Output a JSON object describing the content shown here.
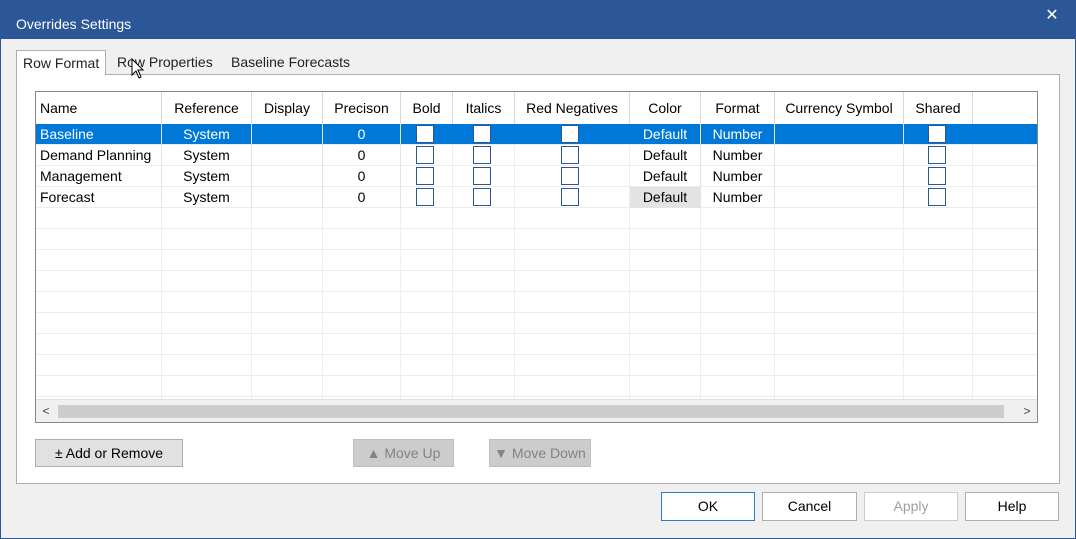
{
  "window": {
    "title": "Overrides Settings",
    "close_label": "✕"
  },
  "tabs": [
    {
      "label": "Row Format",
      "active": true
    },
    {
      "label": "Row Properties",
      "active": false
    },
    {
      "label": "Baseline Forecasts",
      "active": false
    }
  ],
  "grid": {
    "columns": [
      "Name",
      "Reference",
      "Display",
      "Precison",
      "Bold",
      "Italics",
      "Red Negatives",
      "Color",
      "Format",
      "Currency Symbol",
      "Shared"
    ],
    "rows": [
      {
        "name": "Baseline",
        "reference": "System",
        "display": "",
        "precision": "0",
        "bold": false,
        "italics": false,
        "red_negatives": false,
        "color": "Default",
        "format": "Number",
        "currency_symbol": "",
        "shared": false,
        "selected": true
      },
      {
        "name": "Demand Planning",
        "reference": "System",
        "display": "",
        "precision": "0",
        "bold": false,
        "italics": false,
        "red_negatives": false,
        "color": "Default",
        "format": "Number",
        "currency_symbol": "",
        "shared": false,
        "selected": false
      },
      {
        "name": "Management",
        "reference": "System",
        "display": "",
        "precision": "0",
        "bold": false,
        "italics": false,
        "red_negatives": false,
        "color": "Default",
        "format": "Number",
        "currency_symbol": "",
        "shared": false,
        "selected": false
      },
      {
        "name": "Forecast",
        "reference": "System",
        "display": "",
        "precision": "0",
        "bold": false,
        "italics": false,
        "red_negatives": false,
        "color": "Default",
        "format": "Number",
        "currency_symbol": "",
        "shared": false,
        "selected": false
      }
    ],
    "scroll_left": "<",
    "scroll_right": ">"
  },
  "actions": {
    "add_remove": "± Add or Remove",
    "move_up": "▲ Move Up",
    "move_down": "▼ Move Down"
  },
  "footer": {
    "ok": "OK",
    "cancel": "Cancel",
    "apply": "Apply",
    "help": "Help"
  },
  "colors": {
    "titlebar": "#2b5797",
    "selection": "#0078d7"
  }
}
